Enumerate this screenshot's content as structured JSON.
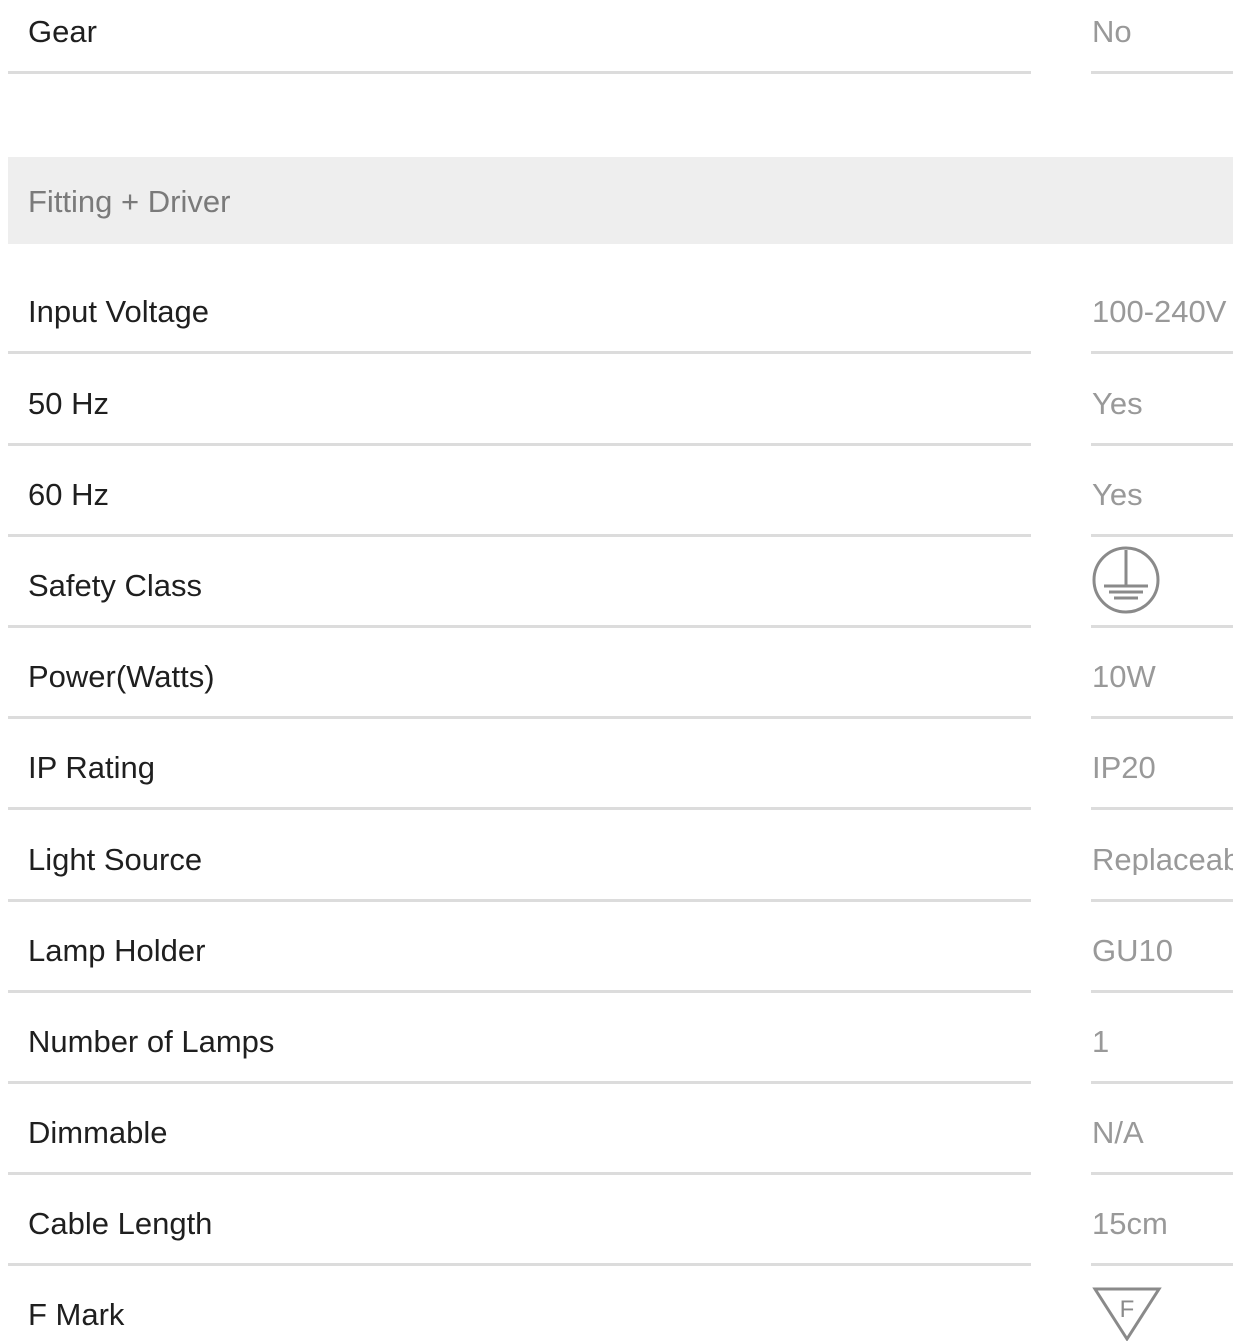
{
  "top_row": {
    "label": "Gear",
    "value": "No"
  },
  "section": {
    "title": "Fitting + Driver",
    "rows": [
      {
        "label": "Input Voltage",
        "value": "100-240V"
      },
      {
        "label": "50 Hz",
        "value": "Yes"
      },
      {
        "label": "60 Hz",
        "value": "Yes"
      },
      {
        "label": "Safety Class",
        "value": "",
        "icon": "earth-ground-icon"
      },
      {
        "label": "Power(Watts)",
        "value": "10W"
      },
      {
        "label": "IP Rating",
        "value": "IP20"
      },
      {
        "label": "Light Source",
        "value": "Replaceable"
      },
      {
        "label": "Lamp Holder",
        "value": "GU10"
      },
      {
        "label": "Number of Lamps",
        "value": "1"
      },
      {
        "label": "Dimmable",
        "value": "N/A"
      },
      {
        "label": "Cable Length",
        "value": "15cm"
      },
      {
        "label": "F Mark",
        "value": "",
        "icon": "f-mark-icon",
        "icon_text": "F"
      }
    ]
  },
  "colors": {
    "label_text": "#1f1f1f",
    "value_text": "#999999",
    "divider": "#dcdcdc",
    "section_bg": "#eeeeee",
    "section_title": "#7a7a7a",
    "icon_stroke": "#8a8a8a"
  }
}
